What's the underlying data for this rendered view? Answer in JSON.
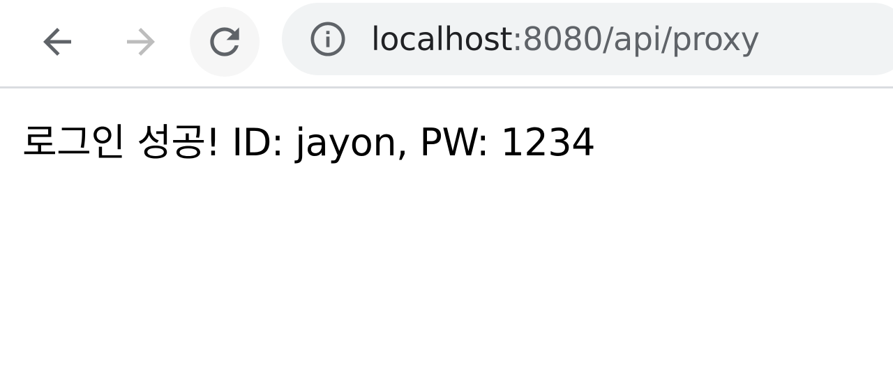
{
  "browser": {
    "url_host": "localhost",
    "url_rest": ":8080/api/proxy",
    "icons": {
      "back": "arrow-left-icon",
      "forward": "arrow-right-icon",
      "reload": "reload-icon",
      "info": "info-icon"
    },
    "colors": {
      "icon_active": "#5f6368",
      "icon_disabled": "#bdbdbd",
      "omnibox_bg": "#f1f3f4"
    }
  },
  "page": {
    "message": "로그인 성공! ID: jayon, PW: 1234"
  }
}
